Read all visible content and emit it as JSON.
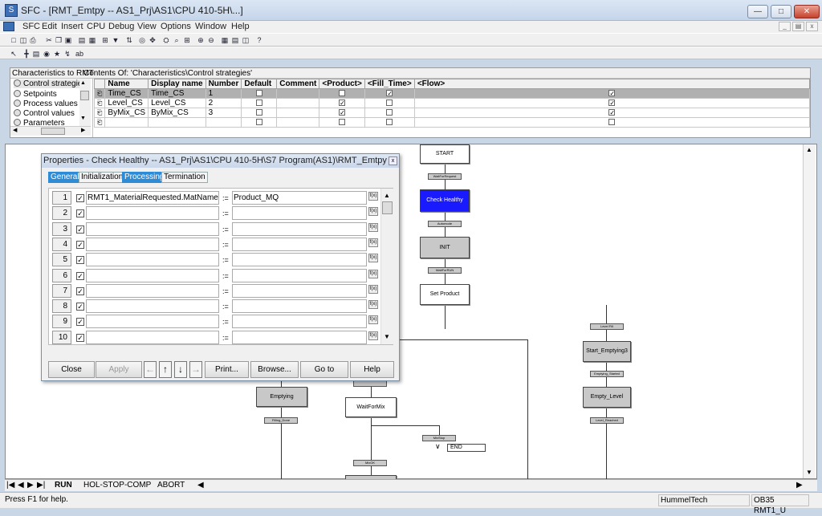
{
  "window": {
    "title": "SFC - [RMT_Emtpy -- AS1_Prj\\AS1\\CPU 410-5H\\...]",
    "app_icon": "sfc-app-icon",
    "controls": [
      "minimize",
      "maximize",
      "close"
    ]
  },
  "menu": {
    "items": [
      "SFC",
      "Edit",
      "Insert",
      "CPU",
      "Debug",
      "View",
      "Options",
      "Window",
      "Help"
    ]
  },
  "characteristics": {
    "header_left": "Characteristics to RMT",
    "header_right": "Contents Of: 'Characteristics\\Control strategies'",
    "tree": [
      "Control strategies",
      "Setpoints",
      "Process values",
      "Control values",
      "Parameters"
    ],
    "columns": [
      "Name",
      "Display name",
      "Number",
      "Default",
      "Comment",
      "<Product>",
      "<Fill_Time>",
      "<Flow>"
    ],
    "rows": [
      {
        "name": "Time_CS",
        "display": "Time_CS",
        "number": "1",
        "default": false,
        "product": false,
        "fill_time": true,
        "flow": true,
        "selected": true
      },
      {
        "name": "Level_CS",
        "display": "Level_CS",
        "number": "2",
        "default": false,
        "product": true,
        "fill_time": false,
        "flow": true,
        "selected": false
      },
      {
        "name": "ByMix_CS",
        "display": "ByMix_CS",
        "number": "3",
        "default": false,
        "product": true,
        "fill_time": false,
        "flow": true,
        "selected": false
      },
      {
        "name": "",
        "display": "",
        "number": "",
        "default": false,
        "product": false,
        "fill_time": false,
        "flow": false,
        "selected": false
      }
    ]
  },
  "sfc": {
    "steps": {
      "start": "START",
      "check_healthy": "Check Healthy",
      "init": "INIT",
      "set_product": "Set Product",
      "start_emptying3": "Start_Emptying3",
      "empty_level": "Empty_Level",
      "emptying": "Emptying",
      "wait_for_mix": "WaitForMix",
      "end": "END"
    },
    "transitions": {
      "wait_for_request": "WaitForRequest",
      "automode": "Automode",
      "wait_for_run": "WaitForRUN",
      "level_fill": "Level Fill",
      "emptying_started": "Emptying_Started",
      "level_reached": "Level_Reached",
      "filling_done": "Filling_Done",
      "mix_stop": "MixStop",
      "mix_ok": "MixOK"
    }
  },
  "properties": {
    "title": "Properties -  Check Healthy -- AS1_Prj\\AS1\\CPU 410-5H\\S7 Program(AS1)\\RMT_Emtpy",
    "tabs": [
      "General",
      "Initialization",
      "Processing",
      "Termination"
    ],
    "active_tabs": [
      "General",
      "Processing"
    ],
    "eq": ":=",
    "fx": "f(x)",
    "rows": [
      {
        "num": "1",
        "left": "RMT1_MaterialRequested.MatName",
        "right": "Product_MQ"
      },
      {
        "num": "2",
        "left": "",
        "right": ""
      },
      {
        "num": "3",
        "left": "",
        "right": ""
      },
      {
        "num": "4",
        "left": "",
        "right": ""
      },
      {
        "num": "5",
        "left": "",
        "right": ""
      },
      {
        "num": "6",
        "left": "",
        "right": ""
      },
      {
        "num": "7",
        "left": "",
        "right": ""
      },
      {
        "num": "8",
        "left": "",
        "right": ""
      },
      {
        "num": "9",
        "left": "",
        "right": ""
      },
      {
        "num": "10",
        "left": "",
        "right": ""
      }
    ],
    "buttons": {
      "close": "Close",
      "apply": "Apply",
      "print": "Print...",
      "browse": "Browse...",
      "goto": "Go to",
      "help": "Help"
    }
  },
  "tabs_bottom": [
    "RUN",
    "HOL-STOP-COMP",
    "ABORT"
  ],
  "status": {
    "help": "Press F1 for help.",
    "user": "HummelTech",
    "ob": "OB35  RMT1_U"
  }
}
